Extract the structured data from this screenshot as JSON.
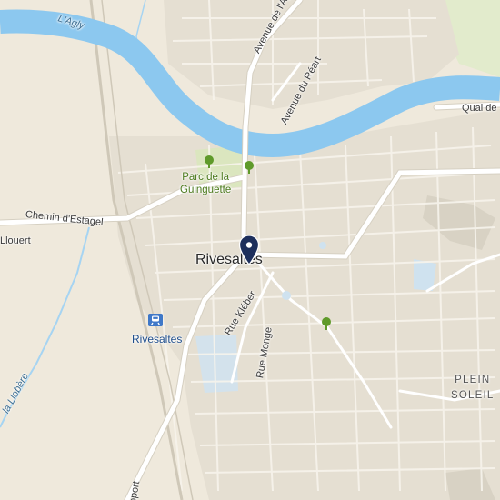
{
  "colors": {
    "land": "#efe9dc",
    "urban": "#e3ddd0",
    "water": "#8cc8ef",
    "road_major": "#ffffff",
    "road_casing": "#d6d0c2",
    "park": "#d8e4b8",
    "building": "#d9d3c5",
    "marker": "#1d2f5c",
    "tree": "#5f9a2a",
    "station_blue": "#3f78c8"
  },
  "labels": {
    "town": "Rivesaltes",
    "river": "L'Agly",
    "river_secondary": "la Llobère",
    "park": [
      "Parc de la",
      "Guinguette"
    ],
    "station": "Rivesaltes",
    "district": [
      "PLEIN",
      "SOLEIL"
    ],
    "streets": {
      "avenue_agly": "Avenue de l'Ag",
      "avenue_reart": "Avenue du Réart",
      "quai": "Quai de",
      "chemin_estagel": "Chemin d'Estagel",
      "llouert": "Llouert",
      "rue_kleber": "Rue Kléber",
      "rue_monge": "Rue Monge",
      "airport": "oport"
    }
  },
  "icons": {
    "marker": "location-pin-icon",
    "station": "train-station-icon",
    "trees": [
      "tree-icon",
      "tree-icon",
      "tree-icon"
    ]
  }
}
